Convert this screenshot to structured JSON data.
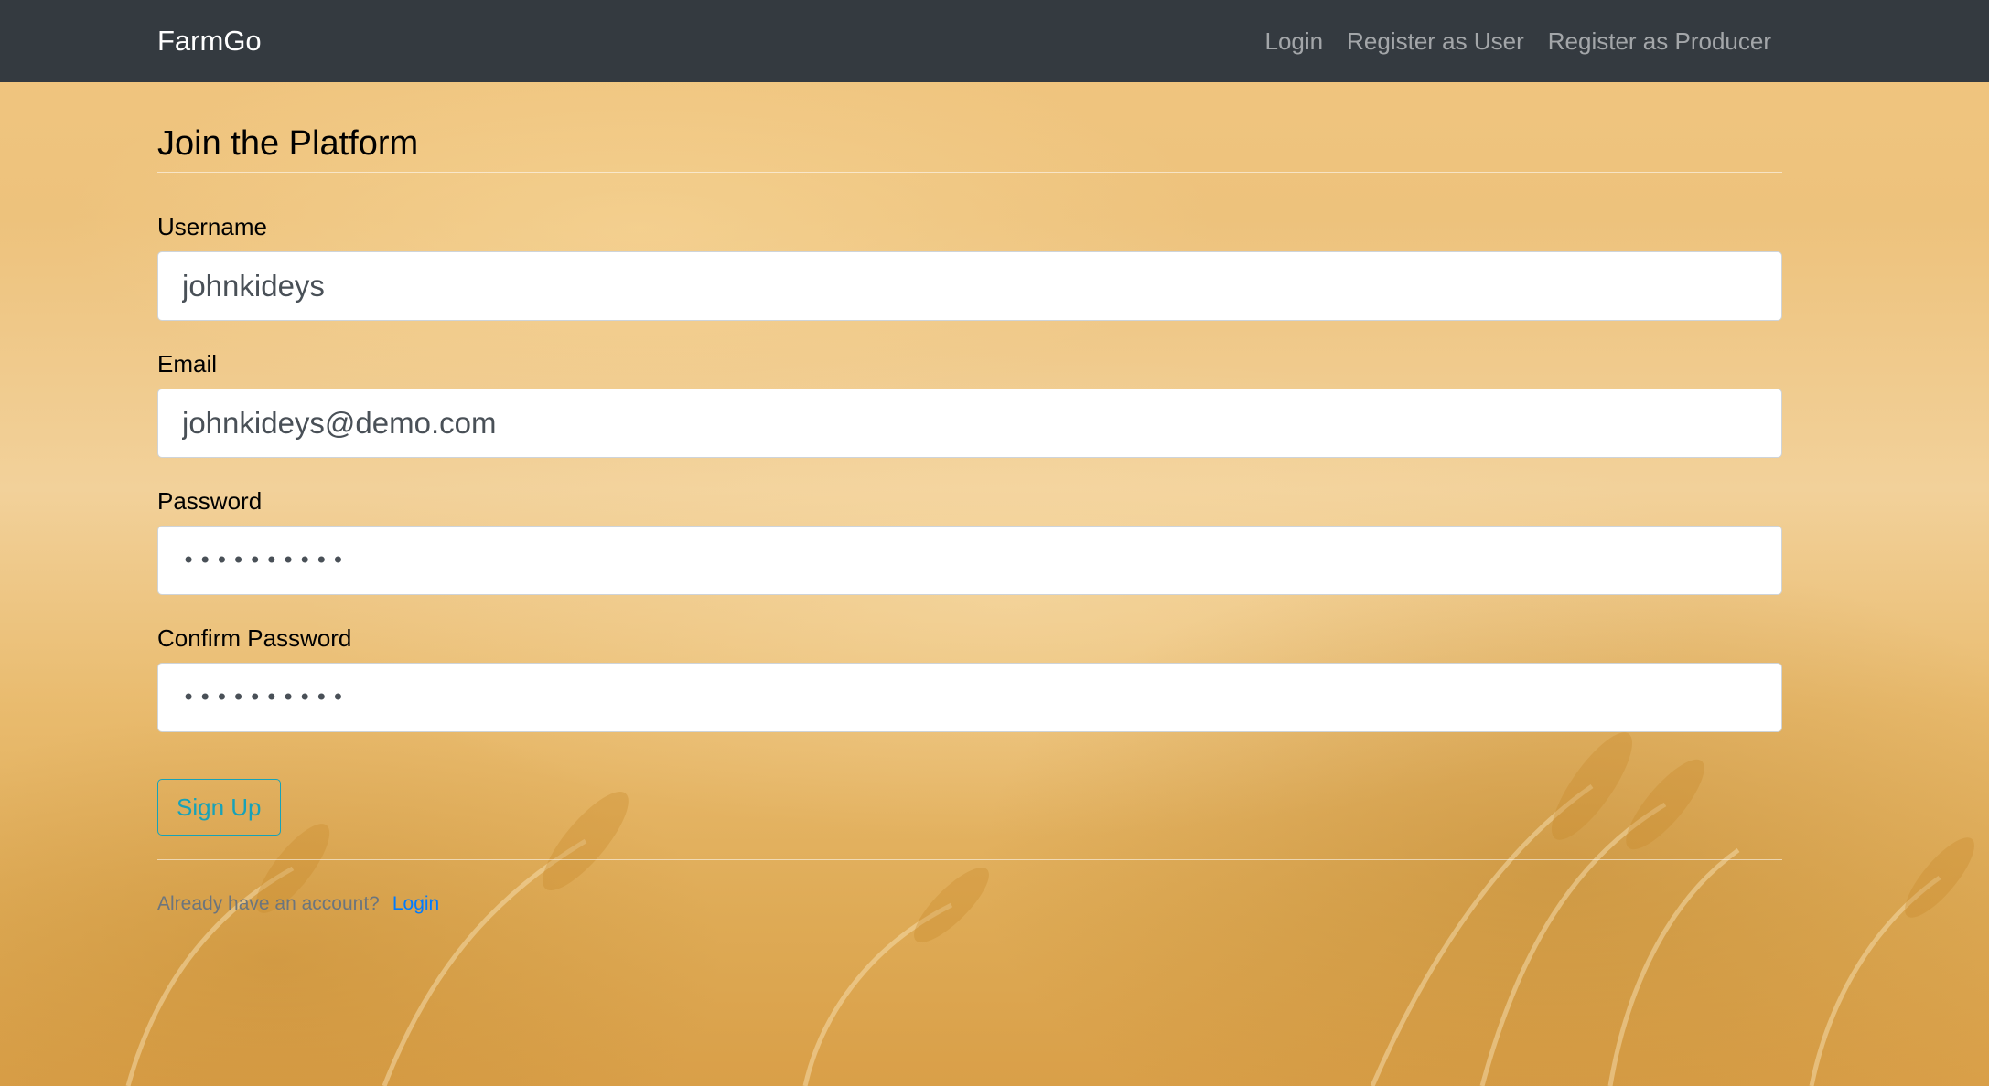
{
  "navbar": {
    "brand": "FarmGo",
    "links": [
      "Login",
      "Register as User",
      "Register as Producer"
    ]
  },
  "form": {
    "title": "Join the Platform",
    "username_label": "Username",
    "username_value": "johnkideys",
    "email_label": "Email",
    "email_value": "johnkideys@demo.com",
    "password_label": "Password",
    "password_value": "••••••••••",
    "confirm_label": "Confirm Password",
    "confirm_value": "••••••••••",
    "submit_label": "Sign Up"
  },
  "footer": {
    "prompt": "Already have an account?",
    "login_link": "Login"
  },
  "colors": {
    "navbar_bg": "#343a40",
    "button_outline": "#17a2b8",
    "link": "#007bff"
  }
}
